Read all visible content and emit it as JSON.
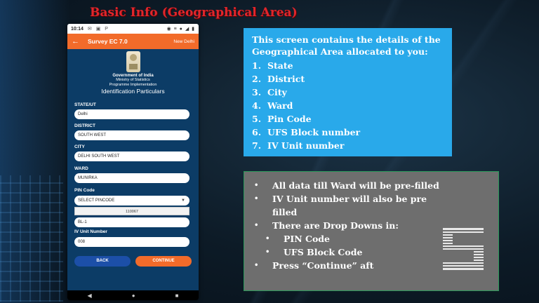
{
  "slide": {
    "title": "Basic Info (Geographical Area)"
  },
  "phone": {
    "status_time": "10:14",
    "status_left_icons": "✉ ▣ P",
    "status_right_icons": "◉ ≡ ● ◢ ▮",
    "app_title": "Survey EC 7.0",
    "app_location": "New Delhi",
    "gov_title": "Government of India",
    "ministry_line1": "Ministry of Statistics",
    "ministry_line2": "Programme Implementation",
    "section_title": "Identification Particulars",
    "fields": {
      "state_label": "STATE/UT",
      "state_value": "Delhi",
      "district_label": "DISTRICT",
      "district_value": "SOUTH WEST",
      "city_label": "CITY",
      "city_value": "DELHI SOUTH WEST",
      "ward_label": "WARD",
      "ward_value": "MUNIRKA",
      "pin_label": "PIN Code",
      "pin_selected": "SELECT PINCODE",
      "pin_option": "110067",
      "ufs_value": "BL-1",
      "iv_label": "IV Unit Number",
      "iv_value": "008"
    },
    "buttons": {
      "back": "BACK",
      "continue": "CONTINUE"
    },
    "nav": {
      "back": "◀",
      "home": "●",
      "recent": "■"
    }
  },
  "info_box": {
    "intro": "This screen  contains the details of the Geographical Area allocated to you:",
    "items": [
      {
        "num": "1.",
        "text": "State"
      },
      {
        "num": "2.",
        "text": "District"
      },
      {
        "num": "3.",
        "text": "City"
      },
      {
        "num": "4.",
        "text": "Ward"
      },
      {
        "num": "5.",
        "text": "Pin Code"
      },
      {
        "num": "6.",
        "text": "UFS Block number"
      },
      {
        "num": "7.",
        "text": "IV Unit number"
      }
    ]
  },
  "notes_box": {
    "bullet": "•",
    "line1": "All data till Ward will be pre-filled",
    "line2a": "IV Unit number will also be pre",
    "line2b": "filled",
    "line3": "There are Drop Downs in:",
    "sub1": "PIN Code",
    "sub2": "UFS Block Code",
    "line4": "Press “Continue” aft"
  },
  "colors": {
    "title_red": "#e0262c",
    "app_orange": "#f26b2a",
    "phone_blue": "#0c3c66",
    "info_blue": "#29a9ea",
    "notes_gray": "#6e6e6e"
  }
}
